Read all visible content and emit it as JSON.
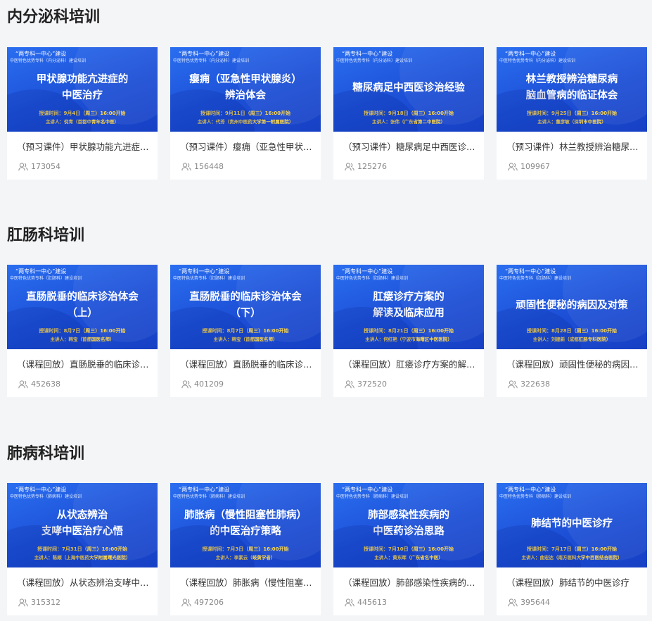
{
  "sections": [
    {
      "title": "内分泌科培训",
      "courses": [
        {
          "brand": "“两专科一中心”建设",
          "subtitle": "中医特色优势专科（内分泌科）建设培训",
          "banner": "甲状腺功能亢进症的\n中医治疗",
          "time": "授课时间：9月4日（周三）16:00开始",
          "speaker": "主讲人：倪青（首都中青年名中医）",
          "name": "（预习课件）甲状腺功能亢进症的中医治疗",
          "views": "173054"
        },
        {
          "brand": "“两专科一中心”建设",
          "subtitle": "中医特色优势专科（内分泌科）建设培训",
          "banner": "瘿痈（亚急性甲状腺炎）\n辨治体会",
          "time": "授课时间：9月11日（周三）16:00开始",
          "speaker": "主讲人：代芳（贵州中医药大学第一附属医院）",
          "name": "（预习课件）瘿痈（亚急性甲状腺炎）辨治体会",
          "views": "156448"
        },
        {
          "brand": "“两专科一中心”建设",
          "subtitle": "中医特色优势专科（内分泌科）建设培训",
          "banner": "糖尿病足中西医诊治经验",
          "time": "授课时间：9月18日（周三）16:00开始",
          "speaker": "主讲人：张伟（广东省第二中医院）",
          "name": "（预习课件）糖尿病足中西医诊治经验",
          "views": "125276"
        },
        {
          "brand": "“两专科一中心”建设",
          "subtitle": "中医特色优势专科（内分泌科）建设培训",
          "banner": "林兰教授辨治糖尿病\n脑血管病的临证体会",
          "time": "授课时间：9月25日（周三）16:00开始",
          "speaker": "主讲人：董彦敏（深圳市中医院）",
          "name": "（预习课件）林兰教授辨治糖尿病脑血管病的临证体会",
          "views": "109967"
        }
      ]
    },
    {
      "title": "肛肠科培训",
      "courses": [
        {
          "brand": "“两专科一中心”建设",
          "subtitle": "中医特色优势专科（肛肠科）建设培训",
          "banner": "直肠脱垂的临床诊治体会\n（上）",
          "time": "授课时间：8月7日（周三）16:00开始",
          "speaker": "主讲人：韩宝（首都国医名师）",
          "name": "（课程回放）直肠脱垂的临床诊治体会（上）",
          "views": "452638"
        },
        {
          "brand": "“两专科一中心”建设",
          "subtitle": "中医特色优势专科（肛肠科）建设培训",
          "banner": "直肠脱垂的临床诊治体会\n（下）",
          "time": "授课时间：8月7日（周三）16:00开始",
          "speaker": "主讲人：韩宝（首都国医名师）",
          "name": "（课程回放）直肠脱垂的临床诊治体会（下）",
          "views": "401209"
        },
        {
          "brand": "“两专科一中心”建设",
          "subtitle": "中医特色优势专科（肛肠科）建设培训",
          "banner": "肛瘘诊疗方案的\n解读及临床应用",
          "time": "授课时间：8月21日（周三）16:00开始",
          "speaker": "主讲人：何红艳（宁波市海曙区中医医院）",
          "name": "（课程回放）肛瘘诊疗方案的解读及临床应用",
          "views": "372520"
        },
        {
          "brand": "“两专科一中心”建设",
          "subtitle": "中医特色优势专科（肛肠科）建设培训",
          "banner": "顽固性便秘的病因及对策",
          "time": "授课时间：8月28日（周三）16:00开始",
          "speaker": "主讲人：刘建新（成都肛肠专科医院）",
          "name": "（课程回放）顽固性便秘的病因及对策",
          "views": "322638"
        }
      ]
    },
    {
      "title": "肺病科培训",
      "courses": [
        {
          "brand": "“两专科一中心”建设",
          "subtitle": "中医特色优势专科（肺病科）建设培训",
          "banner": "从状态辨治\n支哮中医治疗心悟",
          "time": "授课时间：7月31日（周三）16:00开始",
          "speaker": "主讲人：陈顺（上海中医药大学附属曙光医院）",
          "name": "（课程回放）从状态辨治支哮中医治疗心悟",
          "views": "315312"
        },
        {
          "brand": "“两专科一中心”建设",
          "subtitle": "中医特色优势专科（肺病科）建设培训",
          "banner": "肺胀病（慢性阻塞性肺病）\n的中医治疗策略",
          "time": "授课时间：7月3日（周三）16:00开始",
          "speaker": "主讲人：李素云（岐黄学者）",
          "name": "（课程回放）肺胀病（慢性阻塞性肺病）的中医治疗策略",
          "views": "497206"
        },
        {
          "brand": "“两专科一中心”建设",
          "subtitle": "中医特色优势专科（肺病科）建设培训",
          "banner": "肺部感染性疾病的\n中医药诊治思路",
          "time": "授课时间：7月10日（周三）16:00开始",
          "speaker": "主讲人：黄东晖（广东省名中医）",
          "name": "（课程回放）肺部感染性疾病的中医药诊治思路",
          "views": "445613"
        },
        {
          "brand": "“两专科一中心”建设",
          "subtitle": "中医特色优势专科（肺病科）建设培训",
          "banner": "肺结节的中医诊疗",
          "time": "授课时间：7月17日（周三）16:00开始",
          "speaker": "主讲人：曲宏达（南方医科大学中西医结合医院）",
          "name": "（课程回放）肺结节的中医诊疗",
          "views": "395644"
        }
      ]
    }
  ]
}
